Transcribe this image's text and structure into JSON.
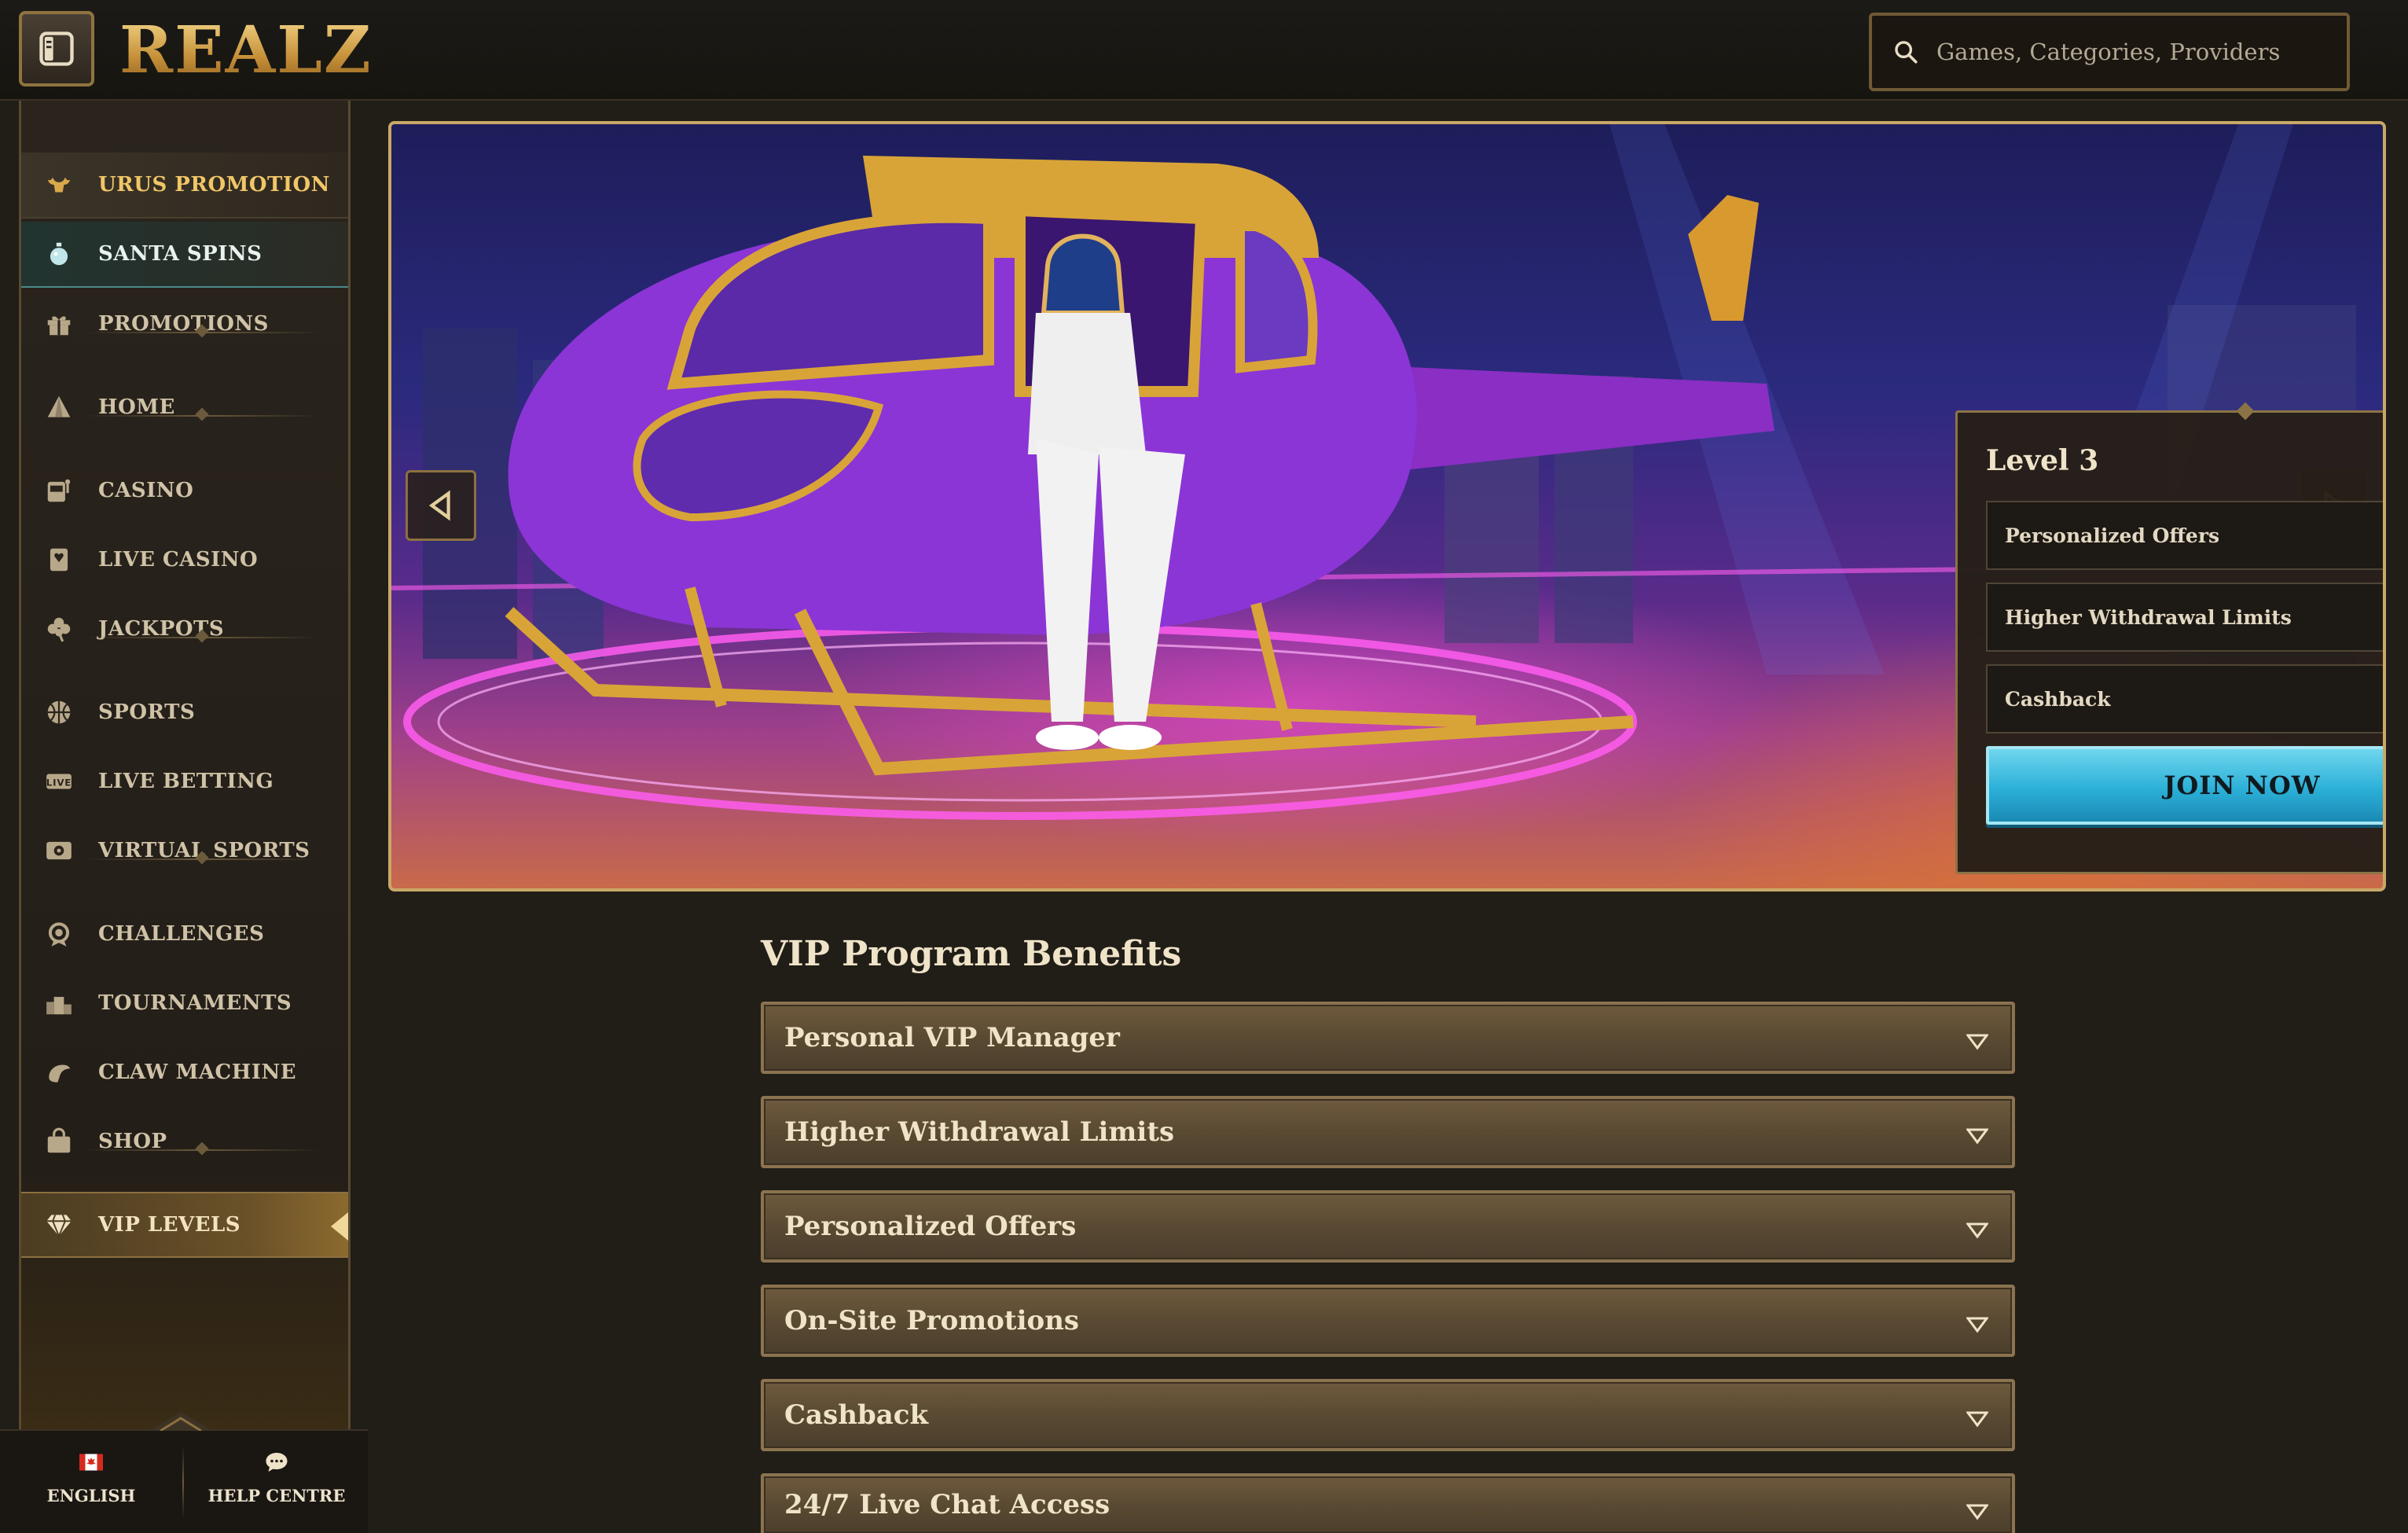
{
  "header": {
    "logo_text": "REALZ",
    "search_placeholder": "Games, Categories, Providers"
  },
  "sidebar": {
    "items": [
      {
        "label": "URUS PROMOTION",
        "icon": "bull-icon"
      },
      {
        "label": "SANTA SPINS",
        "icon": "ornament-icon"
      },
      {
        "label": "PROMOTIONS",
        "icon": "gift-icon"
      },
      {
        "label": "HOME",
        "icon": "pyramid-icon"
      },
      {
        "label": "CASINO",
        "icon": "slot-machine-icon"
      },
      {
        "label": "LIVE CASINO",
        "icon": "playing-card-icon"
      },
      {
        "label": "JACKPOTS",
        "icon": "clover-icon"
      },
      {
        "label": "SPORTS",
        "icon": "basketball-icon"
      },
      {
        "label": "LIVE BETTING",
        "icon": "live-badge-icon"
      },
      {
        "label": "VIRTUAL SPORTS",
        "icon": "virtual-soccer-icon"
      },
      {
        "label": "CHALLENGES",
        "icon": "badge-icon"
      },
      {
        "label": "TOURNAMENTS",
        "icon": "podium-icon"
      },
      {
        "label": "CLAW MACHINE",
        "icon": "claw-icon"
      },
      {
        "label": "SHOP",
        "icon": "shopping-bag-icon"
      },
      {
        "label": "VIP LEVELS",
        "icon": "diamond-icon"
      }
    ],
    "footer": {
      "language_label": "ENGLISH",
      "help_label": "HELP CENTRE"
    }
  },
  "hero": {
    "card": {
      "level_title": "Level 3",
      "perks": [
        "Personalized Offers",
        "Higher Withdrawal Limits",
        "Cashback"
      ],
      "cta_label": "JOIN NOW"
    }
  },
  "benefits": {
    "title": "VIP Program Benefits",
    "items": [
      "Personal VIP Manager",
      "Higher Withdrawal Limits",
      "Personalized Offers",
      "On-Site Promotions",
      "Cashback",
      "24/7 Live Chat Access"
    ]
  },
  "colors": {
    "accent_gold": "#c9a867",
    "cta_blue": "#2cb0d8",
    "background": "#211d17"
  }
}
